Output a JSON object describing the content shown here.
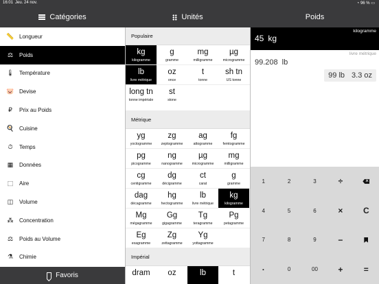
{
  "status": {
    "time": "16:01",
    "date": "Jeu. 24 nov.",
    "battery": "96 %"
  },
  "header": {
    "categories": "Catégories",
    "units": "Unités",
    "current": "Poids"
  },
  "sidebar": {
    "items": [
      {
        "label": "Longueur",
        "icon": "ruler-icon",
        "glyph": "📏"
      },
      {
        "label": "Poids",
        "icon": "weight-icon",
        "glyph": "⚖"
      },
      {
        "label": "Température",
        "icon": "thermometer-icon",
        "glyph": "🌡"
      },
      {
        "label": "Devise",
        "icon": "piggy-bank-icon",
        "glyph": "🐷"
      },
      {
        "label": "Prix au Poids",
        "icon": "price-weight-icon",
        "glyph": "₽"
      },
      {
        "label": "Cuisine",
        "icon": "chef-hat-icon",
        "glyph": "🍳"
      },
      {
        "label": "Temps",
        "icon": "clock-icon",
        "glyph": "⏱"
      },
      {
        "label": "Données",
        "icon": "data-icon",
        "glyph": "▦"
      },
      {
        "label": "Aire",
        "icon": "area-icon",
        "glyph": "⬚"
      },
      {
        "label": "Volume",
        "icon": "volume-icon",
        "glyph": "◫"
      },
      {
        "label": "Concentration",
        "icon": "concentration-icon",
        "glyph": "⁂"
      },
      {
        "label": "Poids au Volume",
        "icon": "scale-icon",
        "glyph": "⚖"
      },
      {
        "label": "Chimie",
        "icon": "flask-icon",
        "glyph": "⚗"
      }
    ],
    "favorites": "Favoris"
  },
  "units": {
    "sections": [
      {
        "title": "Populaire",
        "rows": [
          [
            {
              "sym": "kg",
              "name": "kilogramme",
              "sel": true
            },
            {
              "sym": "g",
              "name": "gramme"
            },
            {
              "sym": "mg",
              "name": "milligramme"
            },
            {
              "sym": "µg",
              "name": "microgramme"
            }
          ],
          [
            {
              "sym": "lb",
              "name": "livre métrique",
              "sel": true
            },
            {
              "sym": "oz",
              "name": "once"
            },
            {
              "sym": "t",
              "name": "tonne"
            },
            {
              "sym": "sh tn",
              "name": "US tonne"
            }
          ],
          [
            {
              "sym": "long tn",
              "name": "tonne impériale"
            },
            {
              "sym": "st",
              "name": "stone"
            }
          ]
        ]
      },
      {
        "title": "Métrique",
        "rows": [
          [
            {
              "sym": "yg",
              "name": "yoctogramme"
            },
            {
              "sym": "zg",
              "name": "zeptogramme"
            },
            {
              "sym": "ag",
              "name": "attogramme"
            },
            {
              "sym": "fg",
              "name": "femtogramme"
            }
          ],
          [
            {
              "sym": "pg",
              "name": "picogramme"
            },
            {
              "sym": "ng",
              "name": "nanogramme"
            },
            {
              "sym": "µg",
              "name": "microgramme"
            },
            {
              "sym": "mg",
              "name": "milligramme"
            }
          ],
          [
            {
              "sym": "cg",
              "name": "centigramme"
            },
            {
              "sym": "dg",
              "name": "décigramme"
            },
            {
              "sym": "ct",
              "name": "carat"
            },
            {
              "sym": "g",
              "name": "gramme"
            }
          ],
          [
            {
              "sym": "dag",
              "name": "décagramme"
            },
            {
              "sym": "hg",
              "name": "hectogramme"
            },
            {
              "sym": "lb",
              "name": "livre métrique"
            },
            {
              "sym": "kg",
              "name": "kilogramme",
              "sel": true
            }
          ],
          [
            {
              "sym": "Mg",
              "name": "mégagramme"
            },
            {
              "sym": "Gg",
              "name": "gigagramme"
            },
            {
              "sym": "Tg",
              "name": "teragramme"
            },
            {
              "sym": "Pg",
              "name": "petagramme"
            }
          ],
          [
            {
              "sym": "Eg",
              "name": "exagramme"
            },
            {
              "sym": "Zg",
              "name": "zettagramme"
            },
            {
              "sym": "Yg",
              "name": "yottagramme"
            }
          ]
        ]
      },
      {
        "title": "Impérial",
        "rows": [
          [
            {
              "sym": "dram",
              "name": ""
            },
            {
              "sym": "oz",
              "name": ""
            },
            {
              "sym": "lb",
              "name": "",
              "sel": true
            },
            {
              "sym": "t",
              "name": ""
            }
          ]
        ]
      }
    ]
  },
  "converter": {
    "input": {
      "value": "45",
      "unit_symbol": "kg",
      "unit_name": "kilogramme"
    },
    "output": {
      "value": "99.208",
      "unit_symbol": "lb",
      "unit_name": "livre métrique",
      "chip_main": "99 lb",
      "chip_sub": "3.3 oz"
    }
  },
  "keypad": {
    "keys": [
      {
        "label": "1",
        "name": "key-1"
      },
      {
        "label": "2",
        "name": "key-2"
      },
      {
        "label": "3",
        "name": "key-3"
      },
      {
        "label": "÷",
        "name": "divide-key",
        "op": true
      },
      {
        "label": "",
        "name": "backspace-key",
        "icon": "backspace-icon"
      },
      {
        "label": "4",
        "name": "key-4"
      },
      {
        "label": "5",
        "name": "key-5"
      },
      {
        "label": "6",
        "name": "key-6"
      },
      {
        "label": "×",
        "name": "multiply-key",
        "op": true
      },
      {
        "label": "C",
        "name": "clear-key",
        "op": true
      },
      {
        "label": "7",
        "name": "key-7"
      },
      {
        "label": "8",
        "name": "key-8"
      },
      {
        "label": "9",
        "name": "key-9"
      },
      {
        "label": "−",
        "name": "minus-key",
        "op": true
      },
      {
        "label": "",
        "name": "favorite-key",
        "icon": "bookmark-icon"
      },
      {
        "label": "·",
        "name": "decimal-key",
        "op": true
      },
      {
        "label": "0",
        "name": "key-0"
      },
      {
        "label": "00",
        "name": "key-00"
      },
      {
        "label": "+",
        "name": "plus-key",
        "op": true
      },
      {
        "label": "=",
        "name": "equals-key",
        "op": true
      }
    ]
  }
}
